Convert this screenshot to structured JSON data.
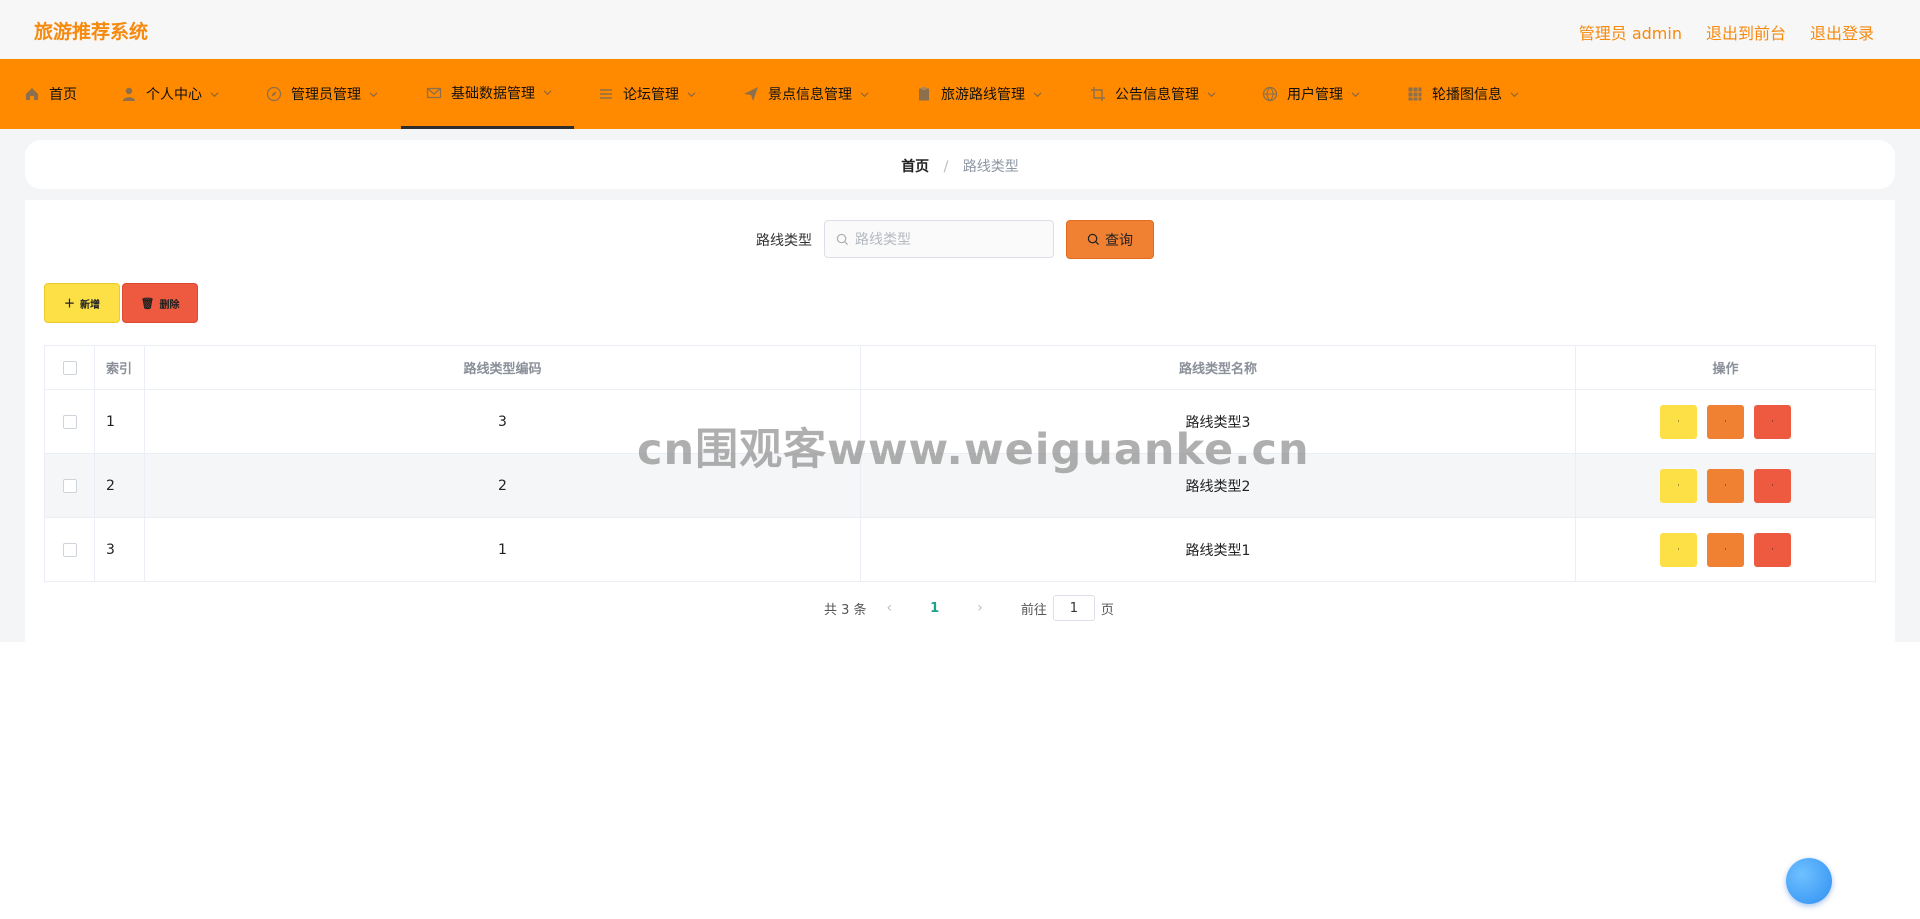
{
  "app": {
    "title": "旅游推荐系统",
    "top_links": [
      "管理员 admin",
      "退出到前台",
      "退出登录"
    ]
  },
  "nav": {
    "items": [
      {
        "label": "首页",
        "icon": "home-icon",
        "dropdown": false,
        "active": false
      },
      {
        "label": "个人中心",
        "icon": "user-icon",
        "dropdown": true,
        "active": false
      },
      {
        "label": "管理员管理",
        "icon": "compass-icon",
        "dropdown": true,
        "active": false
      },
      {
        "label": "基础数据管理",
        "icon": "mail-icon",
        "dropdown": true,
        "active": true
      },
      {
        "label": "论坛管理",
        "icon": "list-icon",
        "dropdown": true,
        "active": false
      },
      {
        "label": "景点信息管理",
        "icon": "send-icon",
        "dropdown": true,
        "active": false
      },
      {
        "label": "旅游路线管理",
        "icon": "clipboard-icon",
        "dropdown": true,
        "active": false
      },
      {
        "label": "公告信息管理",
        "icon": "crop-icon",
        "dropdown": true,
        "active": false
      },
      {
        "label": "用户管理",
        "icon": "globe-icon",
        "dropdown": true,
        "active": false
      },
      {
        "label": "轮播图信息",
        "icon": "grid-icon",
        "dropdown": true,
        "active": false
      }
    ]
  },
  "breadcrumb": {
    "home": "首页",
    "separator": "/",
    "current": "路线类型"
  },
  "search": {
    "label": "路线类型",
    "placeholder": "路线类型",
    "value": "",
    "button": "查询"
  },
  "toolbar": {
    "add": "新增",
    "delete": "删除"
  },
  "table": {
    "headers": {
      "index": "索引",
      "code": "路线类型编码",
      "name": "路线类型名称",
      "actions": "操作"
    },
    "rows": [
      {
        "index": "1",
        "code": "3",
        "name": "路线类型3"
      },
      {
        "index": "2",
        "code": "2",
        "name": "路线类型2"
      },
      {
        "index": "3",
        "code": "1",
        "name": "路线类型1"
      }
    ],
    "action_marks": [
      "·",
      "·",
      "·"
    ]
  },
  "pagination": {
    "total": "共 3 条",
    "current": "1",
    "goto_label": "前往",
    "goto_value": "1",
    "page_suffix": "页"
  },
  "watermark": "cn围观客www.weiguanke.cn",
  "colors": {
    "brand": "#f58a0f",
    "nav_bg": "#ff8a00",
    "view": "#fce045",
    "edit": "#f08133",
    "delete": "#ee5a40",
    "page_active": "#1aa38c"
  }
}
